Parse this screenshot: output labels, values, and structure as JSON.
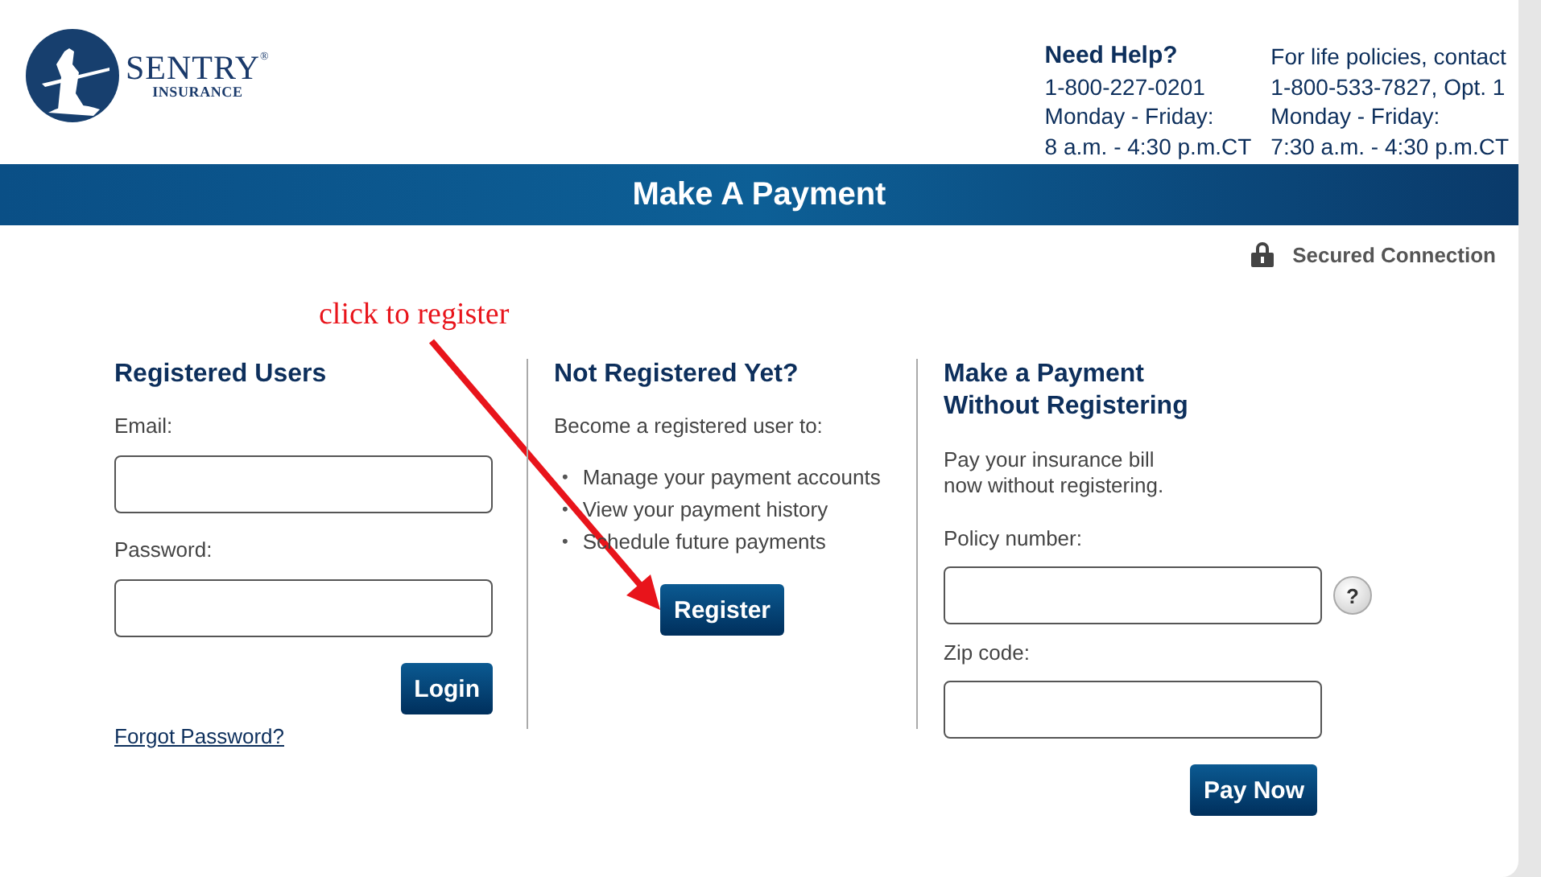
{
  "logo": {
    "name": "SENTRY",
    "registered": "®",
    "subtitle": "INSURANCE"
  },
  "help": [
    {
      "heading": "Need Help?",
      "lines": [
        "1-800-227-0201",
        "Monday - Friday:",
        "8 a.m. - 4:30 p.m.CT"
      ]
    },
    {
      "lines": [
        "For life policies, contact",
        "1-800-533-7827, Opt. 1",
        "Monday - Friday:",
        "7:30 a.m. - 4:30 p.m.CT"
      ]
    }
  ],
  "banner": {
    "title": "Make A Payment"
  },
  "secure": {
    "label": "Secured Connection"
  },
  "annotation": {
    "text": "click to register"
  },
  "registered_users": {
    "heading": "Registered Users",
    "fields": [
      {
        "label": "Email:"
      },
      {
        "label": "Password:"
      }
    ],
    "button": "Login",
    "link": "Forgot Password?"
  },
  "not_registered": {
    "heading": "Not Registered Yet?",
    "intro": "Become a registered user to:",
    "items": [
      {
        "bullet": "•",
        "text": "Manage your payment accounts"
      },
      {
        "bullet": "•",
        "text": "View your payment history"
      },
      {
        "bullet": "•",
        "text": "Schedule future payments"
      }
    ],
    "button": "Register"
  },
  "guest": {
    "heading": [
      "Make a Payment",
      "Without Registering"
    ],
    "intro": [
      "Pay your insurance bill",
      "now without registering."
    ],
    "fields": [
      {
        "label": "Policy number:",
        "help": "?"
      },
      {
        "label": "Zip code:"
      }
    ],
    "button": "Pay Now"
  }
}
